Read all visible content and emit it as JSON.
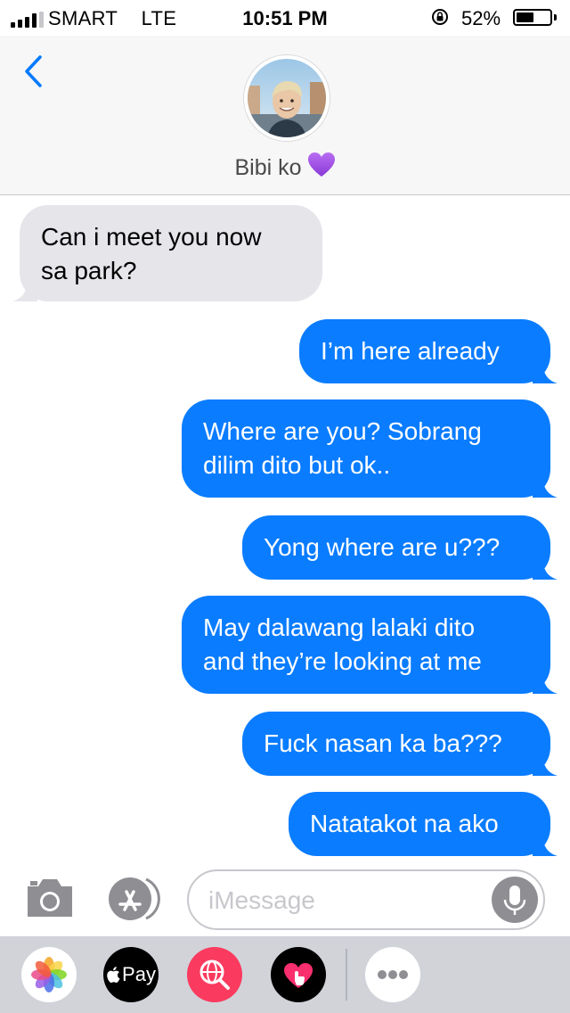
{
  "status_bar": {
    "carrier": "SMART",
    "network": "LTE",
    "time": "10:51 PM",
    "battery_percent": "52%",
    "battery_level": 0.52
  },
  "header": {
    "contact_name": "Bibi ko",
    "contact_emoji": "purple-heart",
    "back_icon": "chevron-left-icon"
  },
  "messages": [
    {
      "direction": "received",
      "lines": [
        "Can i meet you now",
        "sa park?"
      ]
    },
    {
      "direction": "sent",
      "lines": [
        "I’m here already"
      ]
    },
    {
      "direction": "sent",
      "lines": [
        "Where are you? Sobrang",
        "dilim dito but ok.."
      ]
    },
    {
      "direction": "sent",
      "lines": [
        "Yong where are u???"
      ]
    },
    {
      "direction": "sent",
      "lines": [
        "May dalawang lalaki dito",
        "and they’re looking at me"
      ]
    },
    {
      "direction": "sent",
      "lines": [
        "Fuck nasan ka ba???"
      ]
    },
    {
      "direction": "sent",
      "lines": [
        "Natatakot na ako"
      ]
    }
  ],
  "input_bar": {
    "placeholder": "iMessage",
    "camera_icon": "camera-icon",
    "appstore_icon": "app-store-icon",
    "mic_icon": "microphone-icon"
  },
  "app_drawer": {
    "apps": [
      "photos-icon",
      "apple-pay-icon",
      "web-search-icon",
      "digital-touch-icon",
      "more-icon"
    ],
    "apple_pay_label": "Pay"
  },
  "colors": {
    "sent_bubble": "#0a7cff",
    "received_bubble": "#e5e5ea",
    "ios_blue": "#007aff"
  }
}
